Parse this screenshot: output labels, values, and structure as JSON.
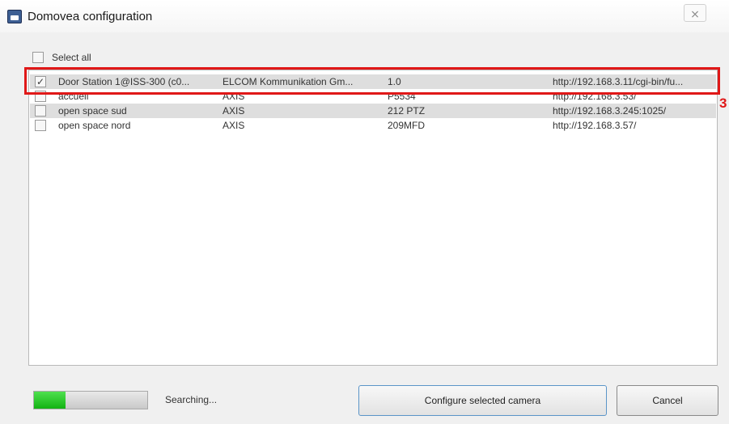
{
  "window": {
    "title": "Domovea configuration",
    "close_glyph": "⨯"
  },
  "select_all": {
    "label": "Select all",
    "checked": false
  },
  "cameras": [
    {
      "checked": true,
      "name": "Door Station 1@ISS-300 (c0...",
      "manufacturer": "ELCOM Kommunikation Gm...",
      "model": "1.0",
      "url": "http://192.168.3.11/cgi-bin/fu..."
    },
    {
      "checked": false,
      "name": "accueil",
      "manufacturer": "AXIS",
      "model": "P5534",
      "url": "http://192.168.3.53/"
    },
    {
      "checked": false,
      "name": "open space sud",
      "manufacturer": "AXIS",
      "model": "212 PTZ",
      "url": "http://192.168.3.245:1025/"
    },
    {
      "checked": false,
      "name": "open space nord",
      "manufacturer": "AXIS",
      "model": "209MFD",
      "url": "http://192.168.3.57/"
    }
  ],
  "annotation": {
    "callout_number": "3",
    "color": "#e01818"
  },
  "footer": {
    "progress_fraction": 0.28,
    "status": "Searching...",
    "configure_label": "Configure selected camera",
    "cancel_label": "Cancel"
  },
  "icons": {
    "app": "domovea-app-icon",
    "close": "close-icon",
    "check": "checkmark-icon"
  }
}
